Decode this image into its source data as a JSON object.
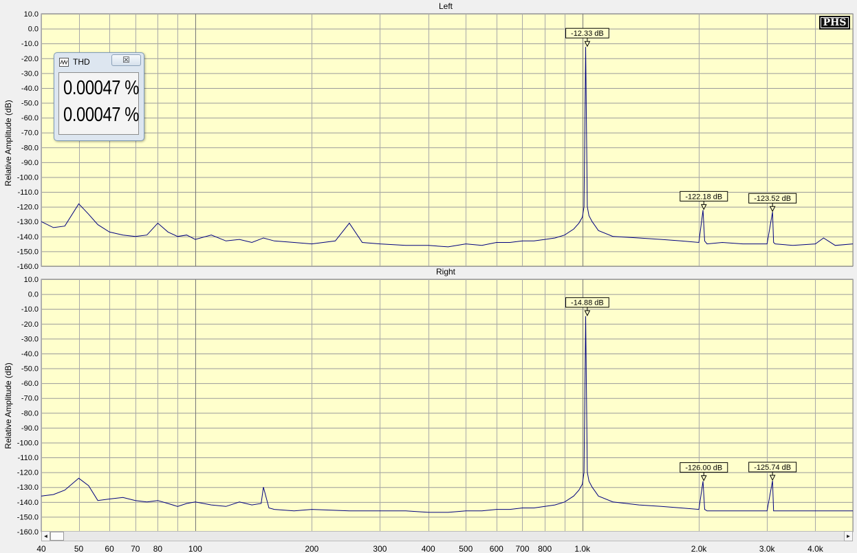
{
  "chart_data": [
    {
      "type": "line",
      "title": "Left",
      "ylabel": "Relative Amplitude (dB)",
      "xlabel": "",
      "x_scale": "log",
      "xlim": [
        40,
        5000
      ],
      "ylim": [
        -160,
        10
      ],
      "yticks": [
        10,
        0,
        -10,
        -20,
        -30,
        -40,
        -50,
        -60,
        -70,
        -80,
        -90,
        -100,
        -110,
        -120,
        -130,
        -140,
        -150,
        -160
      ],
      "ytick_labels": [
        "10.0",
        "0.0",
        "-10.0",
        "-20.0",
        "-30.0",
        "-40.0",
        "-50.0",
        "-60.0",
        "-70.0",
        "-80.0",
        "-90.0",
        "-100.0",
        "-110.0",
        "-120.0",
        "-130.0",
        "-140.0",
        "-150.0",
        "-160.0"
      ],
      "grid": true,
      "background": "#ffffcc",
      "line_color": "#00007f",
      "series": [
        {
          "x": [
            40,
            43,
            46,
            50,
            53,
            56,
            60,
            65,
            70,
            75,
            80,
            85,
            90,
            95,
            100,
            110,
            120,
            130,
            140,
            150,
            160,
            180,
            200,
            230,
            250,
            270,
            300,
            350,
            400,
            450,
            500,
            550,
            600,
            650,
            700,
            750,
            800,
            850,
            900,
            950,
            980,
            1000,
            1010,
            1020,
            1030,
            1040,
            1060,
            1080,
            1100,
            1200,
            1400,
            1600,
            1800,
            2000,
            2050,
            2070,
            2100,
            2300,
            2600,
            3000,
            3100,
            3120,
            3150,
            3500,
            4000,
            4200,
            4500,
            5000
          ],
          "y": [
            -130,
            -134,
            -133,
            -118,
            -125,
            -132,
            -137,
            -139,
            -140,
            -139,
            -131,
            -137,
            -140,
            -139,
            -142,
            -139,
            -143,
            -142,
            -144,
            -141,
            -143,
            -144,
            -145,
            -143,
            -131,
            -144,
            -145,
            -146,
            -146,
            -147,
            -145,
            -146,
            -144,
            -144,
            -143,
            -143,
            -142,
            -141,
            -139,
            -135,
            -131,
            -127,
            -120,
            -12.33,
            -120,
            -126,
            -130,
            -133,
            -136,
            -140,
            -141,
            -142,
            -143,
            -144,
            -122.18,
            -143,
            -145,
            -144,
            -145,
            -145,
            -123.52,
            -144,
            -145,
            -146,
            -145,
            -141,
            -146,
            -145
          ]
        }
      ],
      "markers": [
        {
          "x": 1030,
          "y": -12.33,
          "label": "-12.33 dB"
        },
        {
          "x": 2060,
          "y": -122.18,
          "label": "-122.18 dB"
        },
        {
          "x": 3100,
          "y": -123.52,
          "label": "-123.52 dB"
        }
      ]
    },
    {
      "type": "line",
      "title": "Right",
      "ylabel": "Relative Amplitude (dB)",
      "xlabel": "",
      "x_scale": "log",
      "xlim": [
        40,
        5000
      ],
      "ylim": [
        -160,
        10
      ],
      "yticks": [
        10,
        0,
        -10,
        -20,
        -30,
        -40,
        -50,
        -60,
        -70,
        -80,
        -90,
        -100,
        -110,
        -120,
        -130,
        -140,
        -150,
        -160
      ],
      "ytick_labels": [
        "10.0",
        "0.0",
        "-10.0",
        "-20.0",
        "-30.0",
        "-40.0",
        "-50.0",
        "-60.0",
        "-70.0",
        "-80.0",
        "-90.0",
        "-100.0",
        "-110.0",
        "-120.0",
        "-130.0",
        "-140.0",
        "-150.0",
        "-160.0"
      ],
      "xticks": [
        40,
        50,
        60,
        70,
        80,
        100,
        200,
        300,
        400,
        500,
        600,
        700,
        800,
        1000,
        2000,
        3000,
        4000
      ],
      "xtick_labels": [
        "40",
        "50",
        "60",
        "70",
        "80",
        "100",
        "200",
        "300",
        "400",
        "500",
        "600",
        "700",
        "800",
        "1.0k",
        "2.0k",
        "3.0k",
        "4.0k"
      ],
      "grid": true,
      "background": "#ffffcc",
      "line_color": "#00007f",
      "series": [
        {
          "x": [
            40,
            43,
            46,
            50,
            53,
            56,
            60,
            65,
            70,
            75,
            80,
            85,
            90,
            95,
            100,
            110,
            120,
            130,
            140,
            148,
            150,
            155,
            160,
            180,
            200,
            250,
            300,
            350,
            400,
            450,
            500,
            550,
            600,
            650,
            700,
            750,
            800,
            850,
            900,
            950,
            980,
            1000,
            1010,
            1020,
            1030,
            1040,
            1060,
            1080,
            1100,
            1200,
            1400,
            1600,
            1800,
            2000,
            2050,
            2070,
            2100,
            2300,
            2600,
            3000,
            3100,
            3120,
            3150,
            3500,
            4000,
            4500,
            5000
          ],
          "y": [
            -136,
            -135,
            -132,
            -124,
            -129,
            -139,
            -138,
            -137,
            -139,
            -140,
            -139,
            -141,
            -143,
            -141,
            -140,
            -142,
            -143,
            -140,
            -142,
            -141,
            -130,
            -144,
            -145,
            -146,
            -145,
            -146,
            -146,
            -146,
            -147,
            -147,
            -146,
            -146,
            -145,
            -145,
            -144,
            -144,
            -143,
            -142,
            -140,
            -136,
            -132,
            -128,
            -120,
            -14.88,
            -120,
            -126,
            -130,
            -133,
            -136,
            -140,
            -142,
            -143,
            -144,
            -145,
            -126.0,
            -145,
            -146,
            -146,
            -146,
            -146,
            -125.74,
            -146,
            -146,
            -146,
            -146,
            -146,
            -146
          ]
        }
      ],
      "markers": [
        {
          "x": 1030,
          "y": -14.88,
          "label": "-14.88 dB"
        },
        {
          "x": 2060,
          "y": -126.0,
          "label": "-126.00 dB"
        },
        {
          "x": 3100,
          "y": -125.74,
          "label": "-125.74 dB"
        }
      ]
    }
  ],
  "thd_window": {
    "title": "THD",
    "close_glyph": "☒",
    "values": [
      "0.00047 %",
      "0.00047 %"
    ]
  },
  "logo": "PHS",
  "scrollbar": {
    "left_arrow": "◄",
    "right_arrow": "►"
  }
}
